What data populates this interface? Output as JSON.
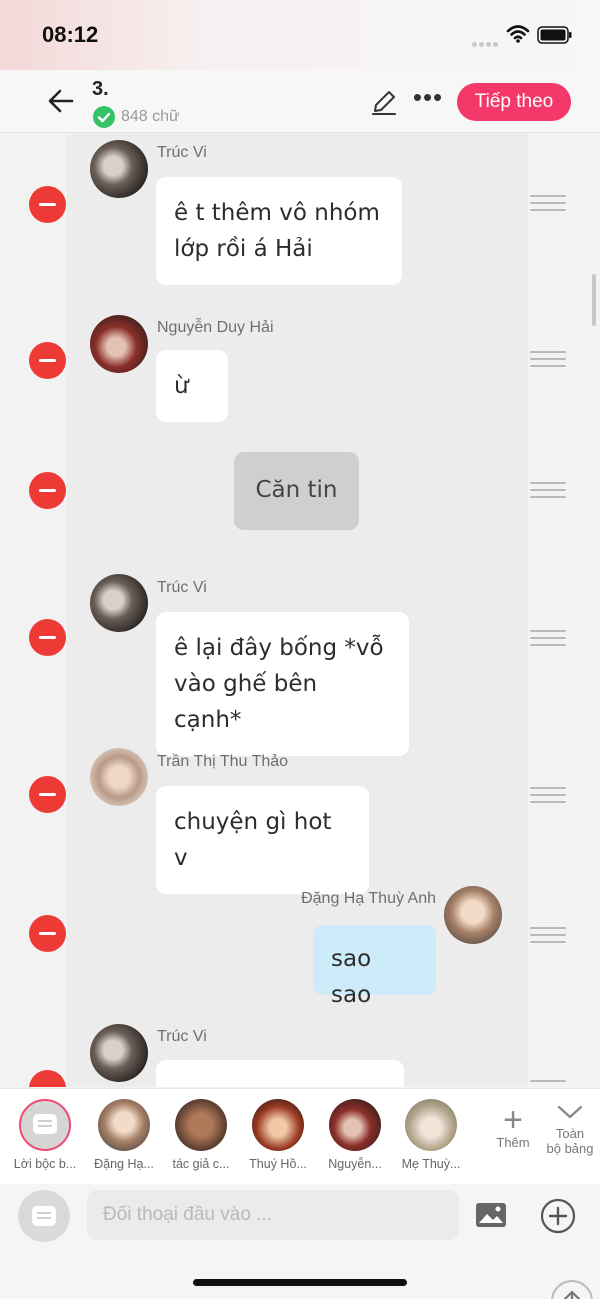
{
  "status_bar": {
    "time": "08:12"
  },
  "header": {
    "chapter_title": "3.",
    "word_count": "848 chữ",
    "next_button": "Tiếp theo"
  },
  "messages": [
    {
      "type": "left",
      "author": "Trúc Vi",
      "text": [
        "ê t thêm vô nhóm",
        "lớp rồi á Hải"
      ]
    },
    {
      "type": "left",
      "author": "Nguyễn Duy Hải",
      "text": [
        "ừ"
      ]
    },
    {
      "type": "narration",
      "text": [
        "Căn tin"
      ]
    },
    {
      "type": "left",
      "author": "Trúc Vi",
      "text": [
        "ê lại đây bống *vỗ",
        "vào ghế bên cạnh*"
      ]
    },
    {
      "type": "left",
      "author": "Trần Thị Thu Thảo",
      "text": [
        "chuyện gì hot v"
      ]
    },
    {
      "type": "right",
      "author": "Đặng Hạ Thuỳ Anh",
      "text": [
        "sao sao"
      ]
    },
    {
      "type": "left",
      "author": "Trúc Vi",
      "text": [
        ""
      ]
    }
  ],
  "characters": [
    {
      "label": "Lời bộc b...",
      "selected": true
    },
    {
      "label": "Đặng Hạ..."
    },
    {
      "label": "tác giả c..."
    },
    {
      "label": "Thuý Hồ..."
    },
    {
      "label": "Nguyễn..."
    },
    {
      "label": "Mẹ Thuỳ..."
    }
  ],
  "char_actions": {
    "more_label": "Thêm",
    "all_board_line1": "Toàn",
    "all_board_line2": "bộ bảng"
  },
  "input": {
    "placeholder": "Đối thoại đầu vào ..."
  },
  "colors": {
    "accent": "#f5386a",
    "delete": "#ee3a34",
    "bubble_blue": "#ccecfa",
    "check": "#35c266"
  }
}
